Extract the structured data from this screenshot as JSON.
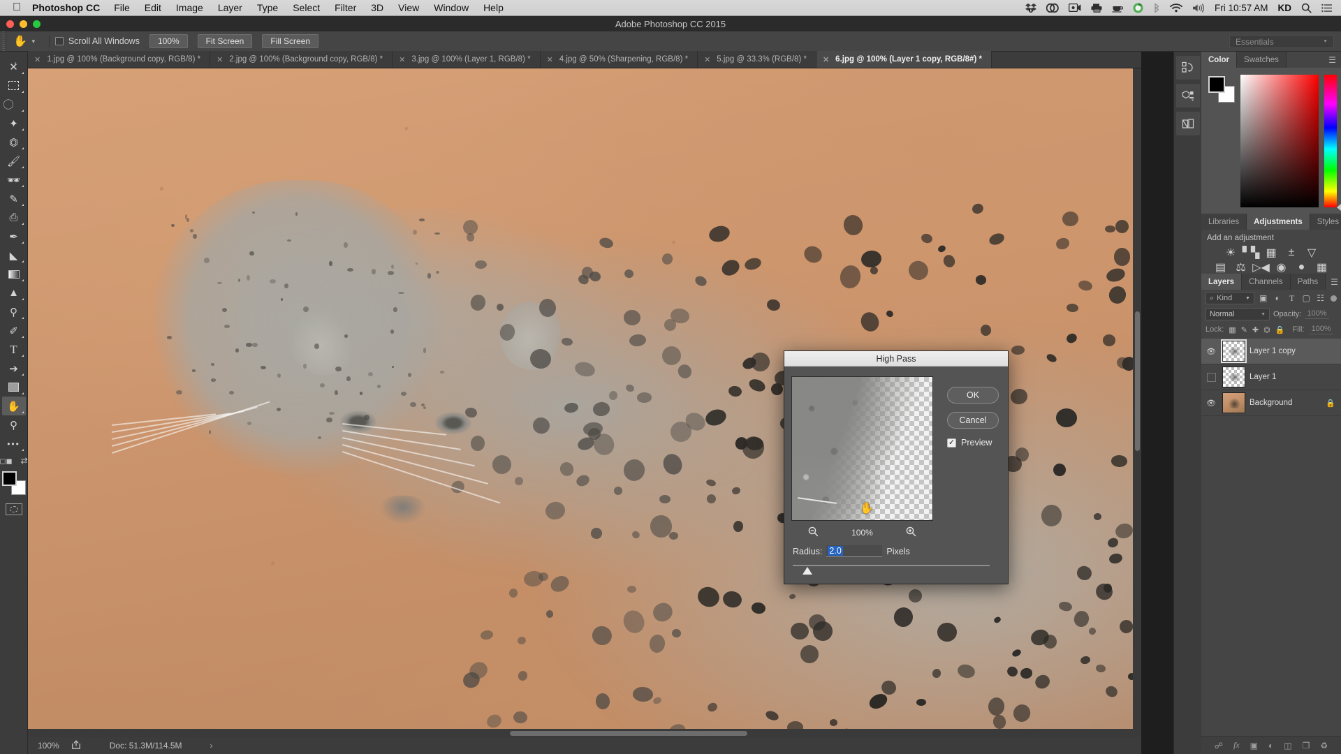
{
  "macbar": {
    "apple_icon": "apple-icon",
    "app_name": "Photoshop CC",
    "menus": [
      "File",
      "Edit",
      "Image",
      "Layer",
      "Type",
      "Select",
      "Filter",
      "3D",
      "View",
      "Window",
      "Help"
    ],
    "status_icons": [
      "dropbox-icon",
      "creative-cloud-icon",
      "screen-record-icon",
      "printer-icon",
      "caffeine-icon",
      "app-circle-icon",
      "bluetooth-icon",
      "wifi-icon",
      "volume-icon"
    ],
    "clock": "Fri 10:57 AM",
    "user_initials": "KD",
    "search_icon": "search-icon",
    "control_center_icon": "list-icon"
  },
  "titlebar": {
    "title": "Adobe Photoshop CC 2015",
    "traffic_colors": [
      "#ff5f57",
      "#febc2e",
      "#28c840"
    ]
  },
  "options": {
    "tool_icon": "hand-tool-icon",
    "scroll_all_windows": "Scroll All Windows",
    "scroll_all_windows_checked": false,
    "buttons": [
      "100%",
      "Fit Screen",
      "Fill Screen"
    ],
    "workspace": "Essentials"
  },
  "tabs": [
    {
      "label": "1.jpg @ 100% (Background copy, RGB/8) *",
      "active": false
    },
    {
      "label": "2.jpg @ 100% (Background copy, RGB/8) *",
      "active": false
    },
    {
      "label": "3.jpg @ 100% (Layer 1, RGB/8) *",
      "active": false
    },
    {
      "label": "4.jpg @ 50% (Sharpening, RGB/8) *",
      "active": false
    },
    {
      "label": "5.jpg @ 33.3% (RGB/8) *",
      "active": false
    },
    {
      "label": "6.jpg @ 100% (Layer 1 copy, RGB/8#) *",
      "active": true
    }
  ],
  "tools": [
    {
      "name": "move-tool",
      "glyph": "✥"
    },
    {
      "name": "marquee-tool",
      "glyph": "▭"
    },
    {
      "name": "lasso-tool",
      "glyph": "◯"
    },
    {
      "name": "quick-selection-tool",
      "glyph": "✧"
    },
    {
      "name": "crop-tool",
      "glyph": "⌗"
    },
    {
      "name": "eyedropper-tool",
      "glyph": "✒"
    },
    {
      "name": "healing-brush-tool",
      "glyph": "✚"
    },
    {
      "name": "brush-tool",
      "glyph": "✎"
    },
    {
      "name": "clone-stamp-tool",
      "glyph": "⎙"
    },
    {
      "name": "history-brush-tool",
      "glyph": "✑"
    },
    {
      "name": "eraser-tool",
      "glyph": "◣"
    },
    {
      "name": "gradient-tool",
      "glyph": "▤"
    },
    {
      "name": "blur-tool",
      "glyph": "▲"
    },
    {
      "name": "dodge-tool",
      "glyph": "⚲"
    },
    {
      "name": "pen-tool",
      "glyph": "✐"
    },
    {
      "name": "type-tool",
      "glyph": "T"
    },
    {
      "name": "path-selection-tool",
      "glyph": "➤"
    },
    {
      "name": "rectangle-tool",
      "glyph": "▢"
    },
    {
      "name": "hand-tool",
      "glyph": "✋",
      "active": true
    },
    {
      "name": "zoom-tool",
      "glyph": "⚲"
    },
    {
      "name": "more-tools",
      "glyph": "•••"
    }
  ],
  "toolbar_footer": {
    "foreground_color": "#000000",
    "background_color": "#ffffff",
    "quick_mask_icon": "quick-mask-icon",
    "swap_icon": "swap-colors-icon",
    "default_icon": "default-colors-icon"
  },
  "statusbar": {
    "zoom": "100%",
    "share_icon": "share-icon",
    "doc_info": "Doc: 51.3M/114.5M",
    "chevron": "›"
  },
  "dock_rail": [
    {
      "name": "history-panel-icon",
      "glyph": "⟲"
    },
    {
      "name": "properties-panel-icon",
      "glyph": "▣"
    },
    {
      "name": "styles-panel-icon",
      "glyph": "◪"
    }
  ],
  "color_panel": {
    "tabs": [
      "Color",
      "Swatches"
    ],
    "active_tab": "Color",
    "menu_icon": "panel-menu-icon",
    "foreground": "#000000",
    "background": "#ffffff",
    "ramp_accent": "#ff0000"
  },
  "adjustments_panel": {
    "tabs": [
      "Libraries",
      "Adjustments",
      "Styles"
    ],
    "active_tab": "Adjustments",
    "menu_icon": "panel-menu-icon",
    "heading": "Add an adjustment",
    "rows": [
      [
        {
          "name": "brightness-contrast-icon",
          "glyph": "☀"
        },
        {
          "name": "levels-icon",
          "glyph": "▥"
        },
        {
          "name": "curves-icon",
          "glyph": "▦"
        },
        {
          "name": "exposure-icon",
          "glyph": "±"
        },
        {
          "name": "vibrance-icon",
          "glyph": "▽"
        }
      ],
      [
        {
          "name": "hue-saturation-icon",
          "glyph": "▤"
        },
        {
          "name": "color-balance-icon",
          "glyph": "⚖"
        },
        {
          "name": "black-white-icon",
          "glyph": "◧"
        },
        {
          "name": "photo-filter-icon",
          "glyph": "◉"
        },
        {
          "name": "channel-mixer-icon",
          "glyph": "◕"
        },
        {
          "name": "color-lookup-icon",
          "glyph": "▦"
        }
      ],
      [
        {
          "name": "invert-icon",
          "glyph": "◨"
        },
        {
          "name": "posterize-icon",
          "glyph": "◩"
        },
        {
          "name": "threshold-icon",
          "glyph": "◪"
        },
        {
          "name": "selective-color-icon",
          "glyph": "✉"
        },
        {
          "name": "gradient-map-icon",
          "glyph": "▣"
        }
      ]
    ]
  },
  "layers_panel": {
    "tabs": [
      "Layers",
      "Channels",
      "Paths"
    ],
    "active_tab": "Layers",
    "menu_icon": "panel-menu-icon",
    "filter": {
      "search_icon": "search-icon",
      "kind_label": "Kind",
      "filter_icons": [
        "pixel-filter-icon",
        "adjustment-filter-icon",
        "type-filter-icon",
        "shape-filter-icon",
        "smart-object-filter-icon"
      ],
      "toggle_icon": "filter-toggle-icon"
    },
    "blend_mode": "Normal",
    "opacity_label": "Opacity:",
    "opacity_value": "100%",
    "lock_label": "Lock:",
    "lock_icons": [
      "lock-transparent-icon",
      "lock-image-icon",
      "lock-position-icon",
      "lock-artboard-icon",
      "lock-all-icon"
    ],
    "fill_label": "Fill:",
    "fill_value": "100%",
    "layers": [
      {
        "name": "Layer 1 copy",
        "visible": true,
        "selected": true,
        "locked": false,
        "thumb": "transparent"
      },
      {
        "name": "Layer 1",
        "visible": false,
        "selected": false,
        "locked": false,
        "thumb": "transparent"
      },
      {
        "name": "Background",
        "visible": true,
        "selected": false,
        "locked": true,
        "thumb": "photo"
      }
    ],
    "footer_icons": [
      {
        "name": "link-layers-icon",
        "glyph": "⛓"
      },
      {
        "name": "layer-style-icon",
        "glyph": "fx"
      },
      {
        "name": "layer-mask-icon",
        "glyph": "◙"
      },
      {
        "name": "new-adjustment-layer-icon",
        "glyph": "◐"
      },
      {
        "name": "new-group-icon",
        "glyph": "▰"
      },
      {
        "name": "new-layer-icon",
        "glyph": "❐"
      },
      {
        "name": "delete-layer-icon",
        "glyph": "🗑"
      }
    ]
  },
  "dialog": {
    "title": "High Pass",
    "ok_label": "OK",
    "cancel_label": "Cancel",
    "preview_label": "Preview",
    "preview_checked": true,
    "zoom_out_icon": "zoom-out-icon",
    "zoom_level": "100%",
    "zoom_in_icon": "zoom-in-icon",
    "radius_label": "Radius:",
    "radius_value": "2.0",
    "radius_unit": "Pixels",
    "slider_position_percent": 7,
    "cursor_icon": "hand-cursor-icon"
  },
  "canvas": {
    "image_subject": "leopard-photo",
    "high_pass_overlay": true
  }
}
